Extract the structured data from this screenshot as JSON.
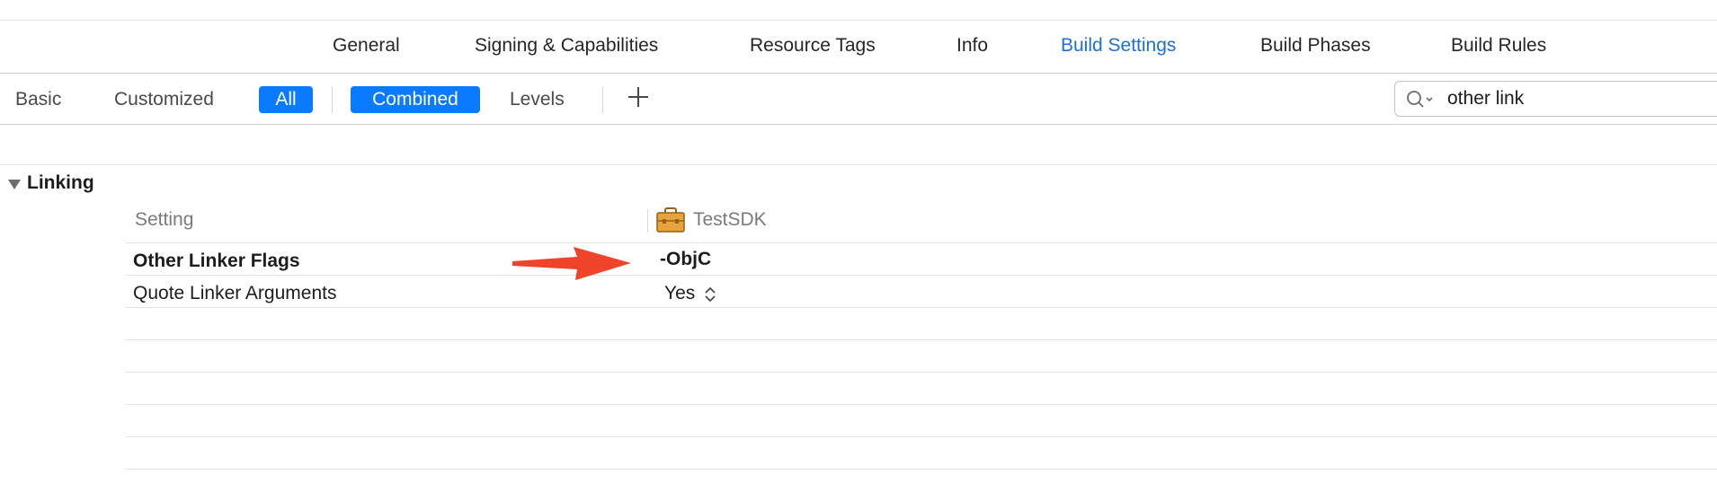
{
  "tabs": [
    {
      "label": "General"
    },
    {
      "label": "Signing & Capabilities"
    },
    {
      "label": "Resource Tags"
    },
    {
      "label": "Info"
    },
    {
      "label": "Build Settings",
      "active": true
    },
    {
      "label": "Build Phases"
    },
    {
      "label": "Build Rules"
    }
  ],
  "filters": {
    "basic": "Basic",
    "customized": "Customized",
    "all": "All",
    "combined": "Combined",
    "levels": "Levels"
  },
  "search": {
    "value": "other link"
  },
  "section": {
    "title": "Linking",
    "column_setting": "Setting",
    "column_target": "TestSDK",
    "rows": [
      {
        "name": "Other Linker Flags",
        "value": "-ObjC"
      },
      {
        "name": "Quote Linker Arguments",
        "value": "Yes"
      }
    ]
  },
  "colors": {
    "accent": "#0a7aff",
    "active_tab": "#1c6fde",
    "annotation_arrow": "#f0442a",
    "target_icon": "#e7a33c"
  },
  "icons": {
    "add": "plus-icon",
    "search": "magnifier-with-chevron",
    "disclosure": "triangle-down",
    "target": "toolbox-icon",
    "popup": "up-down-chevron"
  }
}
